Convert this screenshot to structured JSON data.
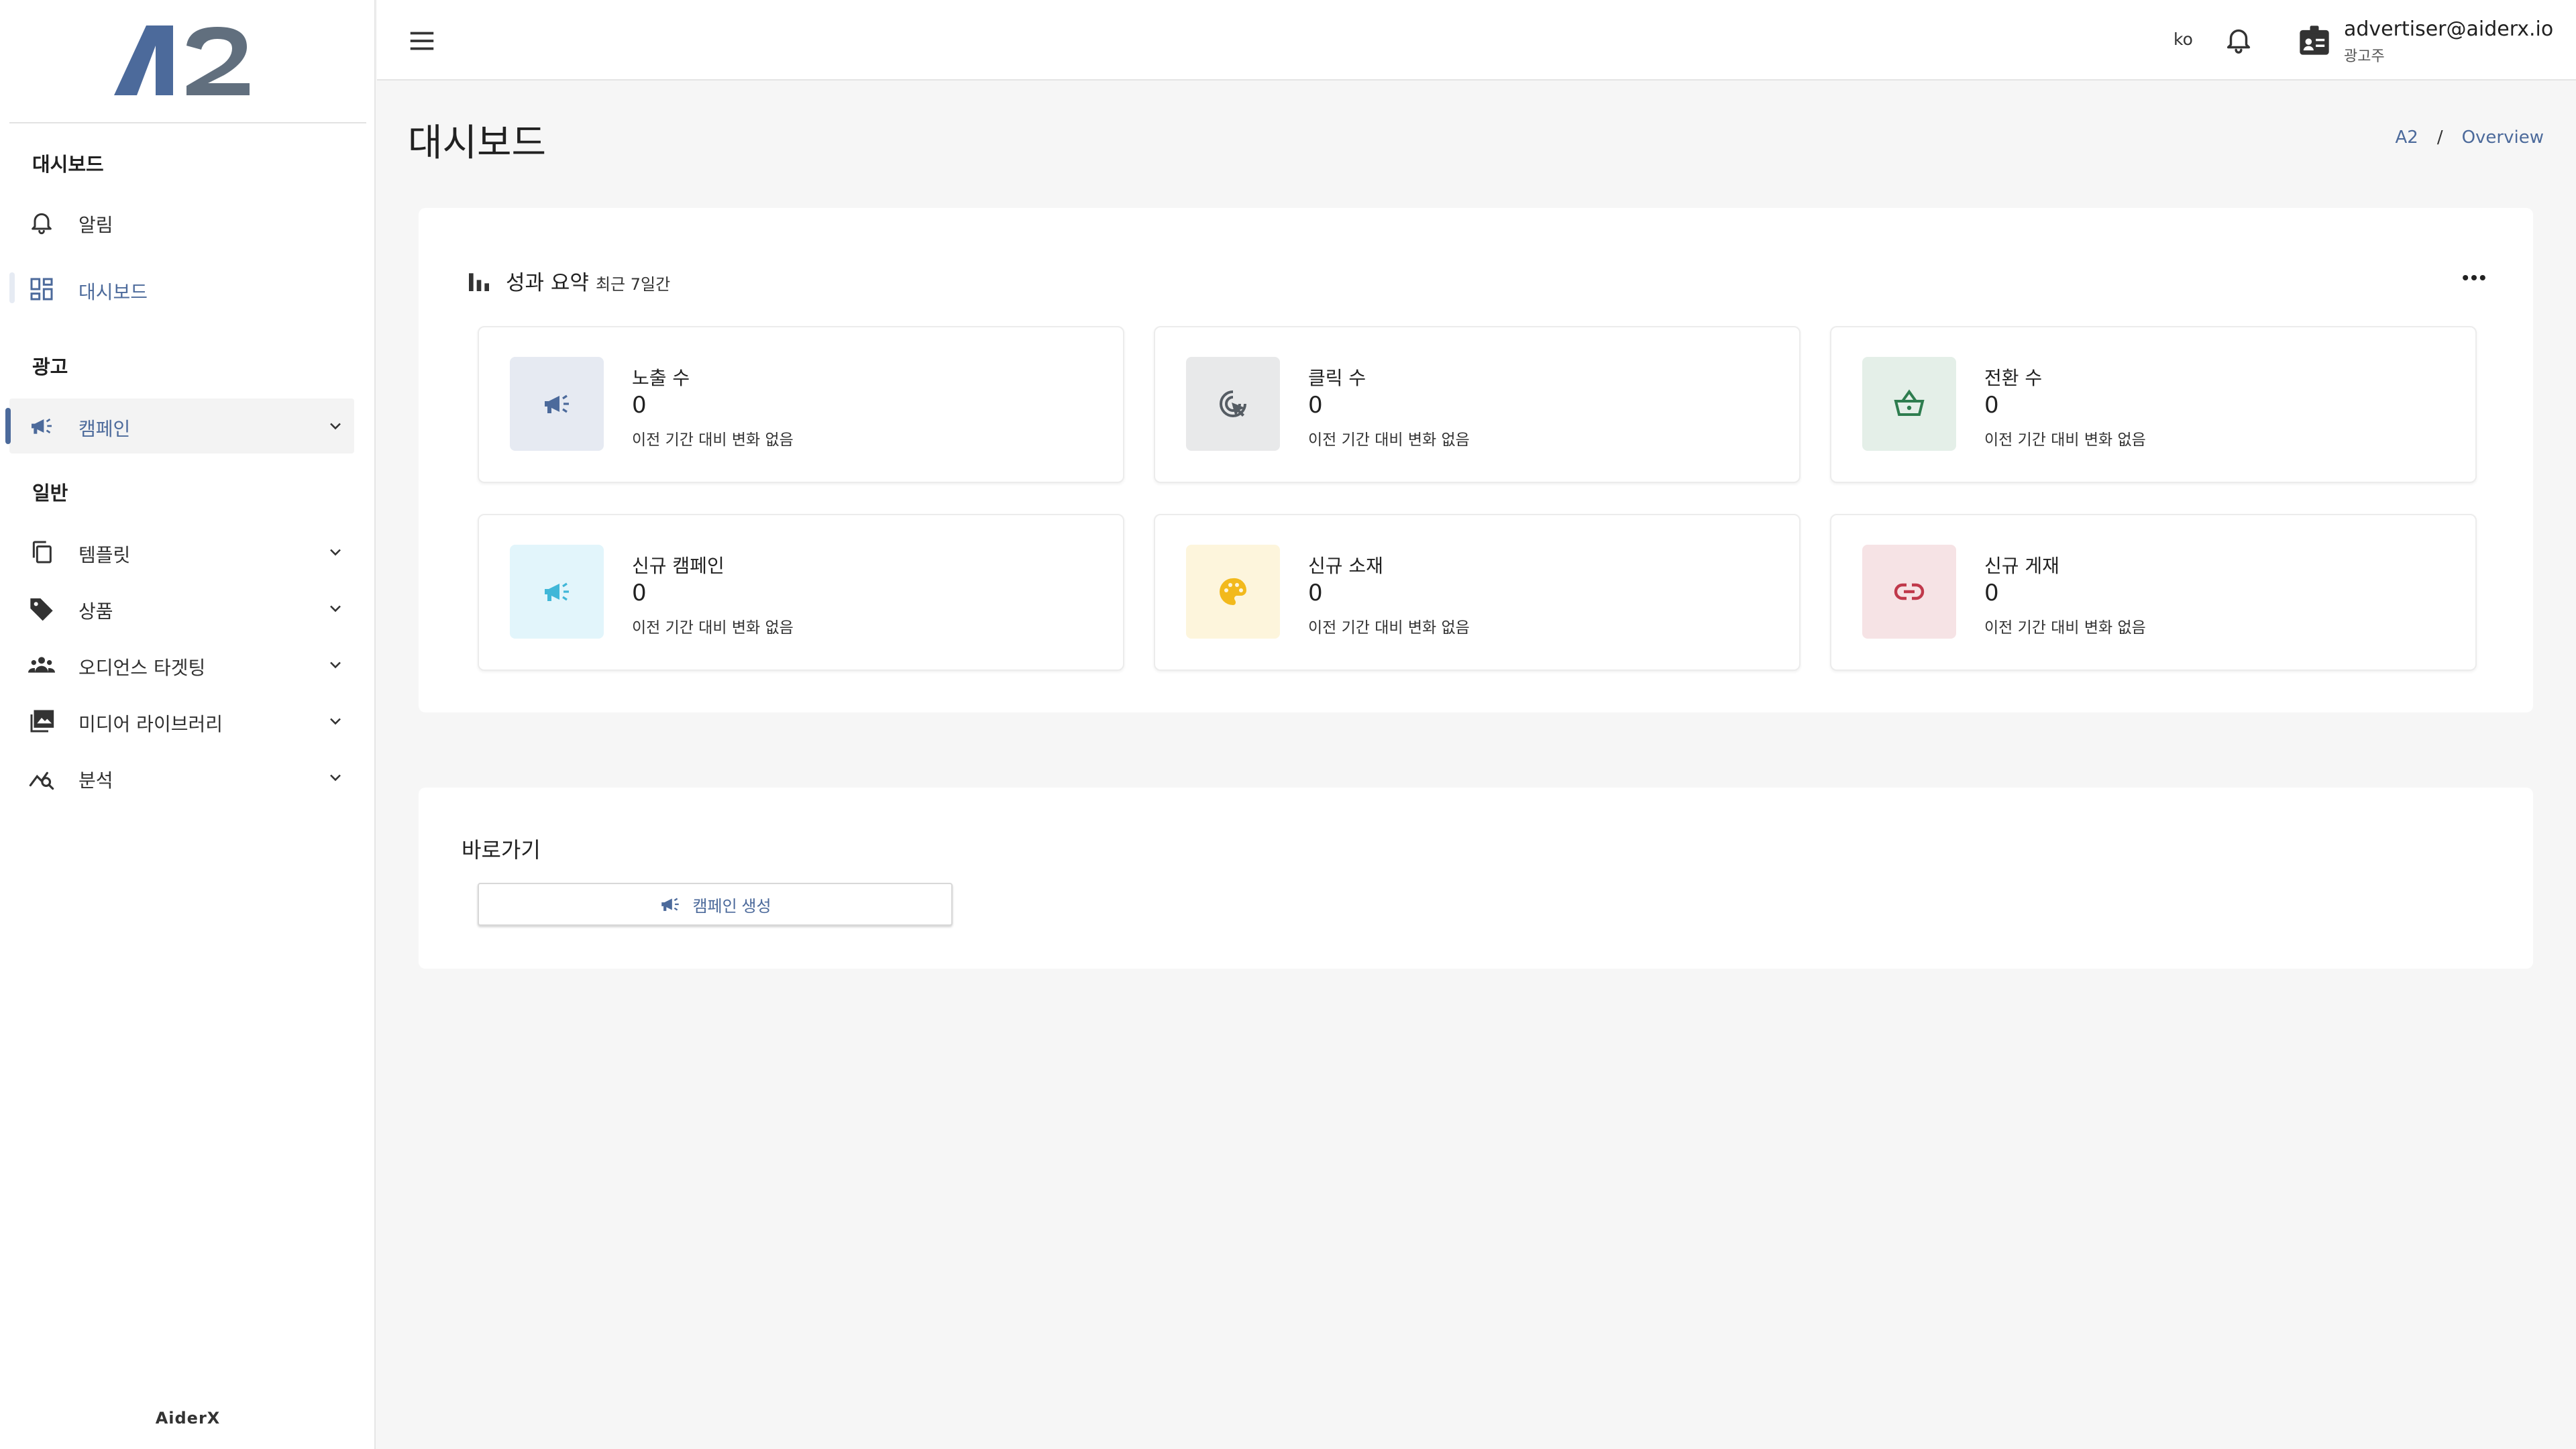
{
  "brand": {
    "logo_text": "A2",
    "footer": "AiderX"
  },
  "sidebar": {
    "sections": [
      {
        "title": "대시보드"
      },
      {
        "title": "광고"
      },
      {
        "title": "일반"
      }
    ],
    "items": [
      {
        "label": "알림",
        "icon": "bell-icon"
      },
      {
        "label": "대시보드",
        "icon": "dashboard-grid-icon"
      },
      {
        "label": "캠페인",
        "icon": "megaphone-icon"
      },
      {
        "label": "템플릿",
        "icon": "copy-icon"
      },
      {
        "label": "상품",
        "icon": "tag-icon"
      },
      {
        "label": "오디언스 타겟팅",
        "icon": "users-icon"
      },
      {
        "label": "미디어 라이브러리",
        "icon": "media-library-icon"
      },
      {
        "label": "분석",
        "icon": "analytics-icon"
      }
    ],
    "active_color": "#4c6a9b"
  },
  "topbar": {
    "language": "ko",
    "user_email": "advertiser@aiderx.io",
    "user_role": "광고주"
  },
  "header": {
    "title": "대시보드",
    "breadcrumb": [
      "A2",
      "/",
      "Overview"
    ]
  },
  "summary": {
    "title": "성과 요약",
    "period": "최근 7일간",
    "stats": [
      {
        "label": "노출 수",
        "value": "0",
        "change": "이전 기간 대비 변화 없음",
        "icon": "megaphone-icon",
        "bg": "#e6eaf2",
        "fg": "#4c6a9b"
      },
      {
        "label": "클릭 수",
        "value": "0",
        "change": "이전 기간 대비 변화 없음",
        "icon": "click-cursor-icon",
        "bg": "#e8e9ea",
        "fg": "#555c63"
      },
      {
        "label": "전환 수",
        "value": "0",
        "change": "이전 기간 대비 변화 없음",
        "icon": "basket-icon",
        "bg": "#e4efe8",
        "fg": "#2e7d4f"
      },
      {
        "label": "신규 캠페인",
        "value": "0",
        "change": "이전 기간 대비 변화 없음",
        "icon": "megaphone-icon",
        "bg": "#e2f5fb",
        "fg": "#40b7d8"
      },
      {
        "label": "신규 소재",
        "value": "0",
        "change": "이전 기간 대비 변화 없음",
        "icon": "palette-icon",
        "bg": "#fdf5dc",
        "fg": "#f2b91c"
      },
      {
        "label": "신규 게재",
        "value": "0",
        "change": "이전 기간 대비 변화 없음",
        "icon": "link-icon",
        "bg": "#f6e3e5",
        "fg": "#c0394b"
      }
    ]
  },
  "shortcuts": {
    "title": "바로가기",
    "create_campaign": "캠페인 생성"
  }
}
